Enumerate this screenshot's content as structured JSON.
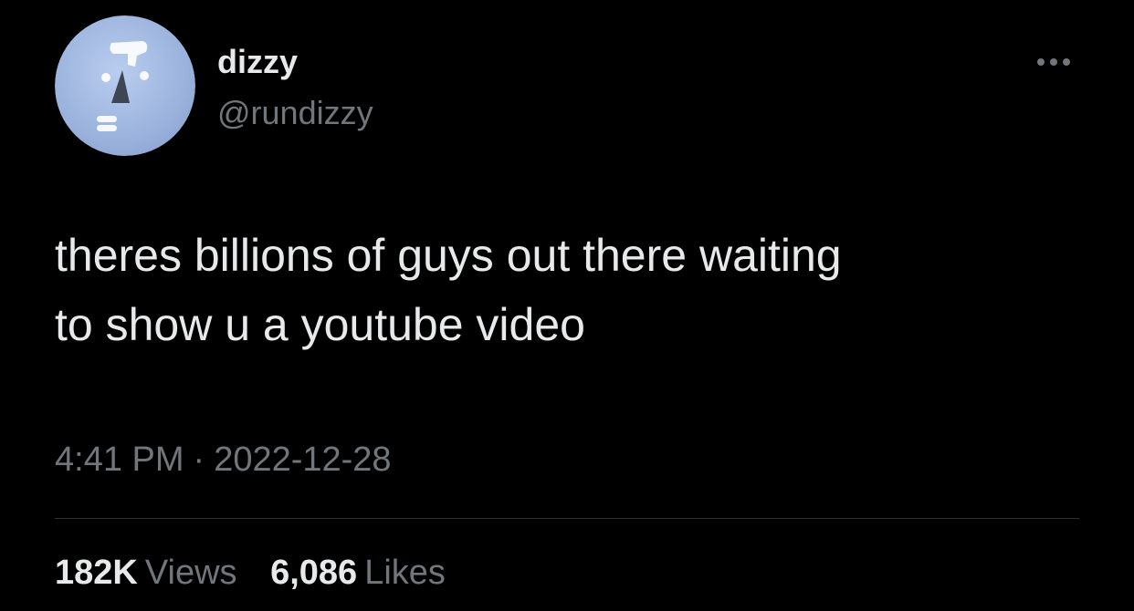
{
  "tweet": {
    "author": {
      "display_name": "dizzy",
      "handle": "@rundizzy",
      "avatar_icon": "moai-face-avatar"
    },
    "more_icon": "more-options-icon",
    "text_lines": [
      "theres billions of guys out there waiting",
      "to show u a youtube video"
    ],
    "timestamp": {
      "time": "4:41 PM",
      "separator": "·",
      "date": "2022-12-28"
    },
    "stats": {
      "views_count": "182K",
      "views_label": "Views",
      "likes_count": "6,086",
      "likes_label": "Likes"
    }
  },
  "colors": {
    "background": "#000000",
    "primary_text": "#e7e9ea",
    "secondary_text": "#71767b",
    "divider": "#2f3336",
    "avatar_bg": "#9fb8e0"
  }
}
